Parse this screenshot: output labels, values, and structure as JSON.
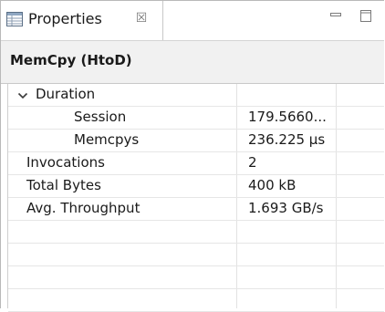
{
  "tab": {
    "label": "Properties",
    "close_glyph": "☒",
    "icon": "properties-table-icon"
  },
  "window_controls": {
    "minimize_icon": "minimize-icon",
    "maximize_icon": "maximize-icon"
  },
  "header": {
    "title": "MemCpy (HtoD)"
  },
  "properties": {
    "rows": [
      {
        "key": "Duration",
        "value": "",
        "expandable": true,
        "expanded": true,
        "indent": 1
      },
      {
        "key": "Session",
        "value": "179.5660...",
        "expandable": false,
        "indent": 2
      },
      {
        "key": "Memcpys",
        "value": "236.225 µs",
        "expandable": false,
        "indent": 2
      },
      {
        "key": "Invocations",
        "value": "2",
        "expandable": false,
        "indent": 1
      },
      {
        "key": "Total Bytes",
        "value": "400 kB",
        "expandable": false,
        "indent": 1
      },
      {
        "key": "Avg. Throughput",
        "value": "1.693 GB/s",
        "expandable": false,
        "indent": 1
      }
    ]
  },
  "colors": {
    "header_bg": "#f1f1f1",
    "grid_line": "#e2e2e2",
    "text": "#1a1a1a"
  }
}
